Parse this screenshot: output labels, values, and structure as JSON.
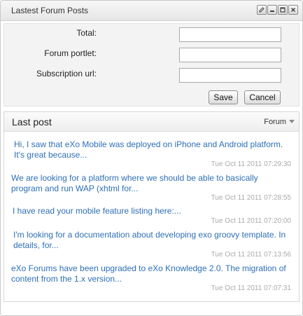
{
  "window": {
    "title": "Lastest Forum Posts",
    "controls": [
      "edit-icon",
      "minimize-icon",
      "maximize-icon",
      "close-icon"
    ]
  },
  "form": {
    "total_label": "Total:",
    "total_value": "",
    "forum_portlet_label": "Forum portlet:",
    "forum_portlet_value": "",
    "subscription_url_label": "Subscription url:",
    "subscription_url_value": "",
    "save_label": "Save",
    "cancel_label": "Cancel"
  },
  "posts_panel": {
    "title": "Last post",
    "dropdown_label": "Forum",
    "posts": [
      {
        "text": "Hi, I saw that eXo Mobile was deployed on iPhone and Android platform. It's great because...",
        "date": "Tue Oct 11 2011 07:29:30"
      },
      {
        "text": "We are looking for a platform where we should be able to basically program and run WAP (xhtml for...",
        "date": "Tue Oct 11 2011 07:28:55"
      },
      {
        "text": "I have read your mobile feature listing here:...",
        "date": "Tue Oct 11 2011 07:20:00"
      },
      {
        "text": "I'm looking for a documentation about developing exo groovy template. In details, for...",
        "date": "Tue Oct 11 2011 07:13:56"
      },
      {
        "text": "eXo Forums have been upgraded to eXo Knowledge 2.0. The migration of content from the 1.x version...",
        "date": "Tue Oct 11 2011 07:07:31"
      }
    ]
  },
  "colors": {
    "link": "#2e6fb6",
    "date": "#aaaaaa",
    "form_bg": "#f3f3f3"
  }
}
